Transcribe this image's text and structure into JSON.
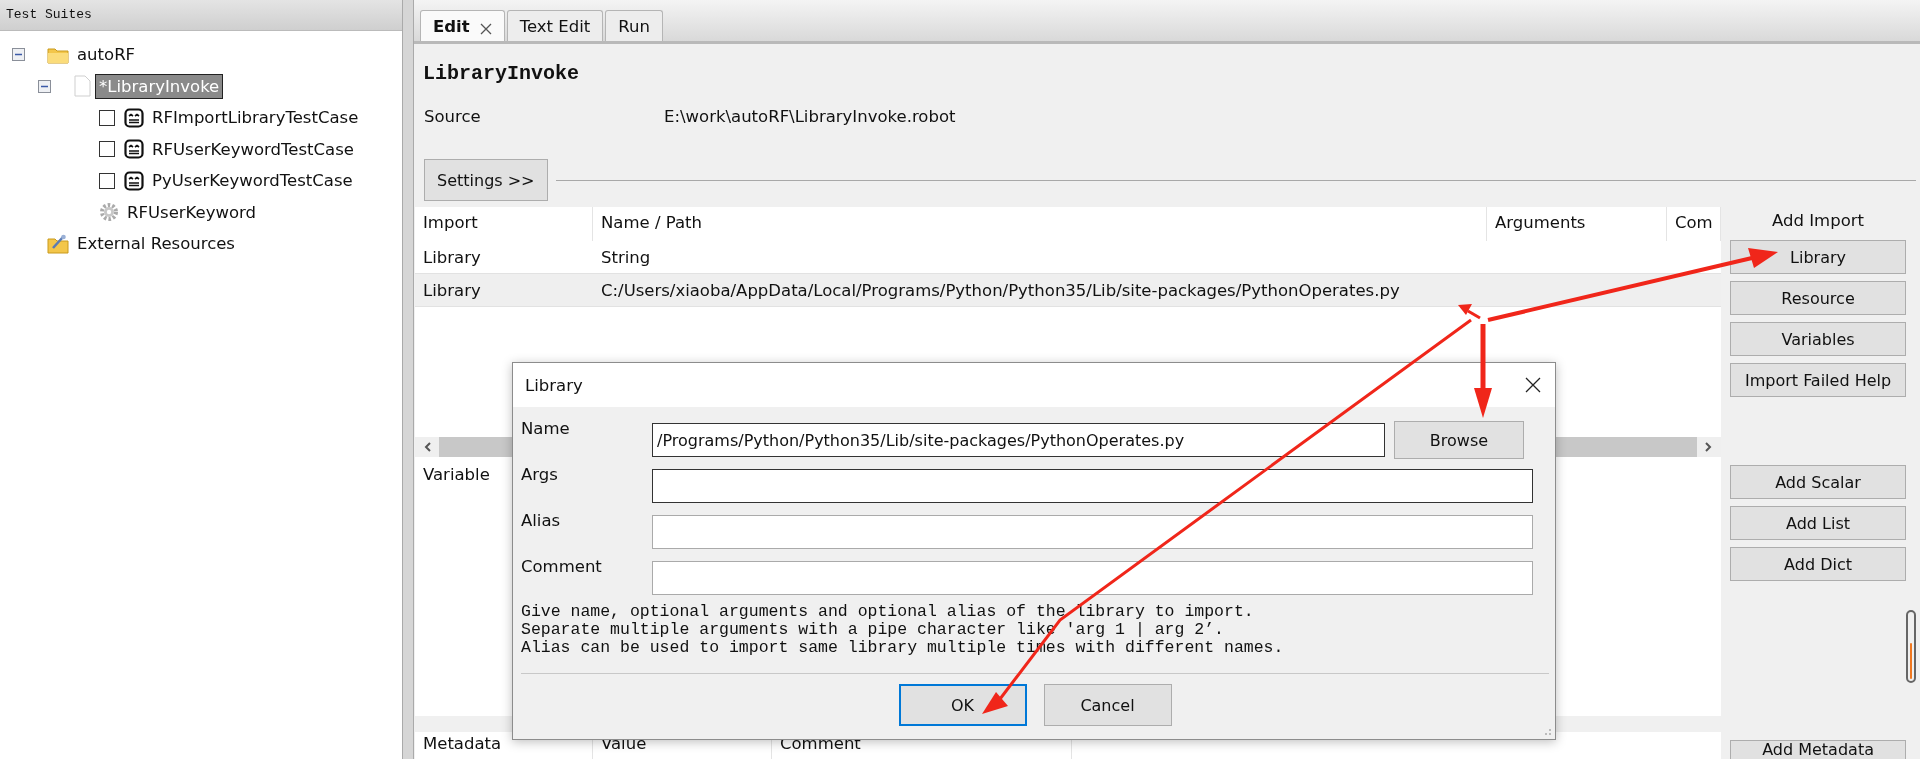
{
  "left_panel": {
    "title": "Test Suites",
    "tree": [
      {
        "label": "autoRF",
        "kind": "folder",
        "expanded": true,
        "selected": false,
        "children": [
          {
            "label": "*LibraryInvoke",
            "kind": "file",
            "expanded": true,
            "selected": true,
            "children": [
              {
                "label": "RFImportLibraryTestCase",
                "kind": "testcase",
                "checked": false,
                "selected": false
              },
              {
                "label": "RFUserKeywordTestCase",
                "kind": "testcase",
                "checked": false,
                "selected": false
              },
              {
                "label": "PyUserKeywordTestCase",
                "kind": "testcase",
                "checked": false,
                "selected": false
              },
              {
                "label": "RFUserKeyword",
                "kind": "keyword",
                "selected": false
              }
            ]
          }
        ]
      },
      {
        "label": "External Resources",
        "kind": "resources",
        "selected": false
      }
    ]
  },
  "tabs": [
    {
      "label": "Edit",
      "selected": true,
      "closable": true
    },
    {
      "label": "Text Edit",
      "selected": false,
      "closable": false
    },
    {
      "label": "Run",
      "selected": false,
      "closable": false
    }
  ],
  "editor": {
    "title": "LibraryInvoke",
    "source_label": "Source",
    "source_value": "E:\\work\\autoRF\\LibraryInvoke.robot",
    "settings_button": "Settings >>",
    "imports": {
      "columns": [
        "Import",
        "Name / Path",
        "Arguments",
        "Com"
      ],
      "rows": [
        {
          "cells": [
            "Library",
            "String"
          ],
          "selected": false
        },
        {
          "cells": [
            "Library",
            "C:/Users/xiaoba/AppData/Local/Programs/Python/Python35/Lib/site-packages/PythonOperates.py"
          ],
          "selected": true
        }
      ]
    },
    "import_buttons_title": "Add Import",
    "import_buttons": [
      "Library",
      "Resource",
      "Variables",
      "Import Failed Help"
    ],
    "variables_label": "Variable",
    "variable_buttons": [
      "Add Scalar",
      "Add List",
      "Add Dict"
    ],
    "metadata_columns": [
      "Metadata",
      "Value",
      "Comment"
    ],
    "metadata_button": "Add Metadata"
  },
  "dialog": {
    "title": "Library",
    "fields": [
      {
        "label": "Name",
        "value": "/Programs/Python/Python35/Lib/site-packages/PythonOperates.py"
      },
      {
        "label": "Args"
      },
      {
        "label": "Alias"
      },
      {
        "label": "Comment"
      }
    ],
    "browse_button": "Browse",
    "help_lines": [
      "Give name, optional arguments and optional alias of the library to import.",
      "Separate multiple arguments with a pipe character like 'arg 1 | arg 2’.",
      "Alias can be used to import same library multiple times with different names."
    ],
    "buttons": [
      {
        "label": "OK",
        "default": true
      },
      {
        "label": "Cancel",
        "default": false
      }
    ]
  }
}
